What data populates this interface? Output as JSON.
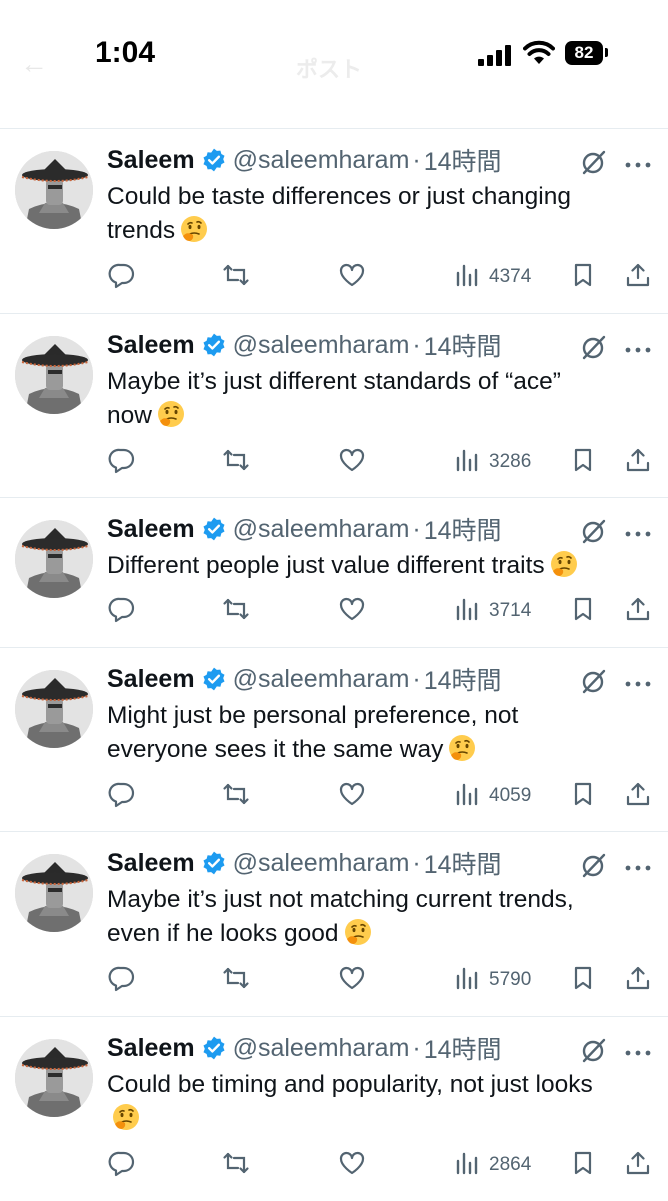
{
  "status_bar": {
    "time": "1:04",
    "battery": "82"
  },
  "header": {
    "back_icon": "arrow-left-icon",
    "title": "ポスト"
  },
  "tweets": [
    {
      "name": "Saleem",
      "handle": "@saleemharam",
      "separator": "·",
      "time": "14時間",
      "text": "Could be taste differences or just changing trends",
      "views": "4374"
    },
    {
      "name": "Saleem",
      "handle": "@saleemharam",
      "separator": "·",
      "time": "14時間",
      "text": "Maybe it’s just different standards of “ace” now",
      "views": "3286"
    },
    {
      "name": "Saleem",
      "handle": "@saleemharam",
      "separator": "·",
      "time": "14時間",
      "text": "Different people just value different traits",
      "views": "3714"
    },
    {
      "name": "Saleem",
      "handle": "@saleemharam",
      "separator": "·",
      "time": "14時間",
      "text": "Might just be personal preference, not everyone sees it the same way",
      "views": "4059"
    },
    {
      "name": "Saleem",
      "handle": "@saleemharam",
      "separator": "·",
      "time": "14時間",
      "text": "Maybe it’s just not matching current trends, even if he looks good",
      "views": "5790"
    },
    {
      "name": "Saleem",
      "handle": "@saleemharam",
      "separator": "·",
      "time": "14時間",
      "text": "Could be timing and popularity, not just looks",
      "views": "2864"
    }
  ],
  "icons": {
    "reply": "reply-icon",
    "repost": "repost-icon",
    "like": "like-icon",
    "views": "views-icon",
    "bookmark": "bookmark-icon",
    "share": "share-icon",
    "grok": "grok-icon",
    "more": "more-icon",
    "verified": "verified-badge-icon",
    "emoji": "thinking-face-emoji"
  },
  "colors": {
    "verified": "#1d9bf0",
    "secondary_text": "#536471",
    "divider": "#e6ecf0"
  }
}
